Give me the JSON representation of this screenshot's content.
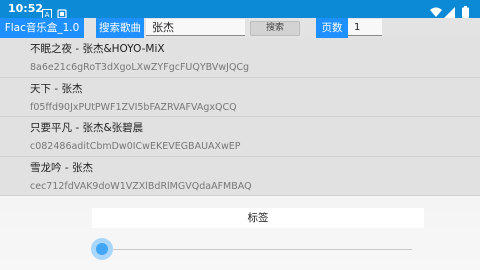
{
  "status_bar": {
    "time": "10:52",
    "notification_icons": [
      "notification-a-icon",
      "notification-b-icon"
    ],
    "right_icons": [
      "wifi-icon",
      "signal-icon",
      "battery-icon"
    ]
  },
  "toolbar": {
    "app_title": "Flac音乐盒_1.0",
    "search_label": "搜索歌曲",
    "search_value": "张杰",
    "search_button": "搜索",
    "page_label": "页数",
    "page_value": "1"
  },
  "results": [
    {
      "title": "不眠之夜 - 张杰&HOYO-MiX",
      "hash": "8a6e21c6gRoT3dXgoLXwZYFgcFUQYBVwJQCg"
    },
    {
      "title": "天下 - 张杰",
      "hash": "f05ffd90JxPUtPWF1ZVI5bFAZRVAFVAgxQCQ"
    },
    {
      "title": "只要平凡 - 张杰&张碧晨",
      "hash": "c082486aditCbmDw0ICwEKEVEGBAUAXwEP"
    },
    {
      "title": "雪龙吟 - 张杰",
      "hash": "cec712fdVAK9doW1VZXlBdRlMGVQdaAFMBAQ"
    }
  ],
  "bottom": {
    "tag_label": "标签",
    "slider_value": 0
  },
  "colors": {
    "status_bar": "#0d8ad6",
    "accent": "#1e90ff",
    "slider": "#41a6f7"
  }
}
